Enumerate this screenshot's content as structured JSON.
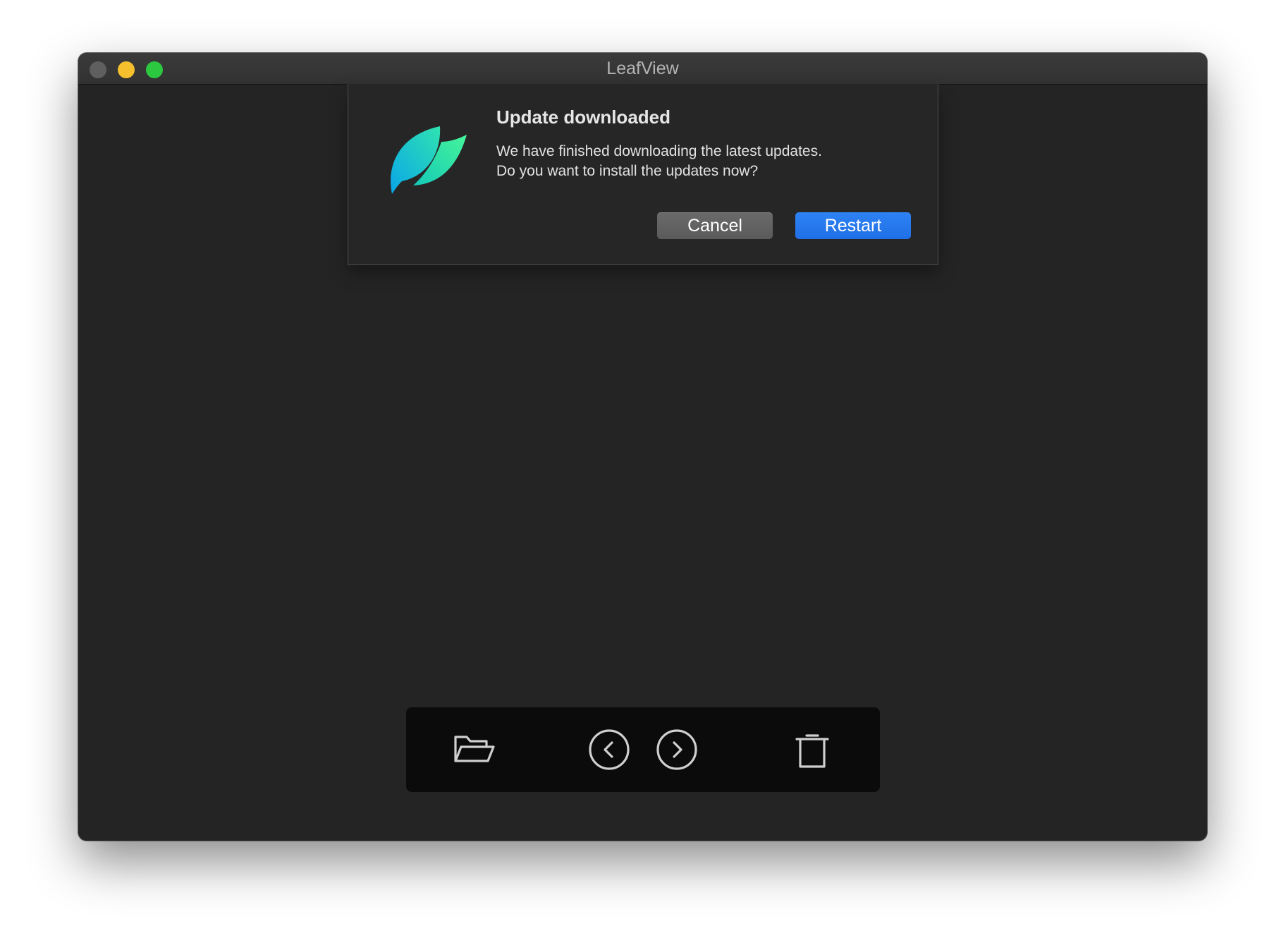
{
  "window": {
    "title": "LeafView"
  },
  "dialog": {
    "title": "Update downloaded",
    "message_line1": "We have finished downloading the latest updates.",
    "message_line2": "Do you want to install the updates now?",
    "cancel_label": "Cancel",
    "restart_label": "Restart",
    "icon": "leaf-app-icon"
  },
  "toolbar": {
    "icons": [
      "folder-open-icon",
      "previous-icon",
      "next-icon",
      "trash-icon"
    ]
  },
  "colors": {
    "window_bg": "#242424",
    "accent": "#1f6fe6",
    "traffic_close": "#5f5f5f",
    "traffic_minimize": "#f5bf2e",
    "traffic_maximize": "#2bc840",
    "leaf_gradient_start": "#0aa6e8",
    "leaf_gradient_end": "#3cf0a0"
  }
}
